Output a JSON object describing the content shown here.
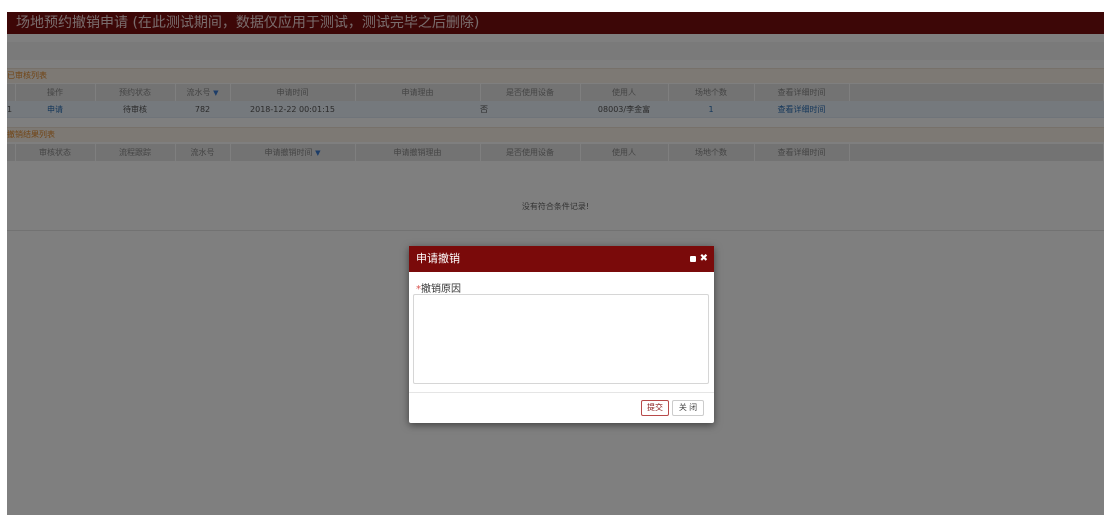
{
  "page": {
    "title": "场地预约撤销申请 (在此测试期间，数据仅应用于测试，测试完毕之后删除)"
  },
  "pending_section": {
    "heading": "已审核列表",
    "columns": [
      "操作",
      "预约状态",
      "流水号",
      "申请时间",
      "申请理由",
      "是否使用设备",
      "使用人",
      "场地个数",
      "查看详细时间"
    ],
    "sort_column_index": 2,
    "rows": [
      {
        "index": "1",
        "action": "申请",
        "status": "待审核",
        "serial": "782",
        "apply_time": "2018-12-22 00:01:15",
        "reason": "",
        "use_equipment": "否",
        "user": "08003/李金富",
        "venue_count": "1",
        "detail": "查看详细时间"
      }
    ]
  },
  "result_section": {
    "heading": "撤销结果列表",
    "columns": [
      "审核状态",
      "流程跟踪",
      "流水号",
      "申请撤销时间",
      "申请撤销理由",
      "是否使用设备",
      "使用人",
      "场地个数",
      "查看详细时间"
    ],
    "sort_column_index": 3,
    "empty_text": "没有符合条件记录!"
  },
  "dialog": {
    "title": "申请撤销",
    "field_label": "撤销原因",
    "required_mark": "*",
    "reason_value": "",
    "submit_label": "提交",
    "close_label": "关 闭"
  },
  "colors": {
    "brand": "#7a0f0f",
    "accent": "#e38b2c",
    "link": "#2a6fb5"
  }
}
